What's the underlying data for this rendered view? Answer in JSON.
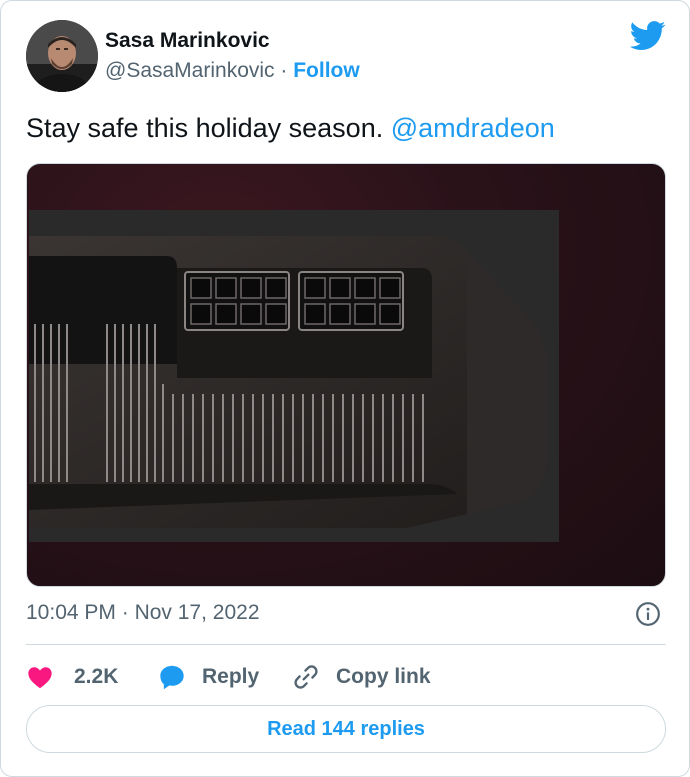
{
  "author": {
    "display_name": "Sasa Marinkovic",
    "handle": "@SasaMarinkovic",
    "separator": "·",
    "follow_label": "Follow",
    "avatar_icon": "avatar-photo"
  },
  "brand_icon": "twitter-bird-icon",
  "tweet": {
    "text": "Stay safe this holiday season.",
    "mention": "@amdradeon",
    "media_icon": "gpu-power-connector-photo"
  },
  "meta": {
    "time": "10:04 PM",
    "separator": "·",
    "date": "Nov 17, 2022"
  },
  "actions": {
    "like_count": "2.2K",
    "reply_label": "Reply",
    "copy_link_label": "Copy link"
  },
  "read_replies_label": "Read 144 replies",
  "colors": {
    "accent": "#1d9bf0",
    "like": "#f91880",
    "muted": "#536471",
    "text": "#0f1419",
    "border": "#cfd9de"
  }
}
